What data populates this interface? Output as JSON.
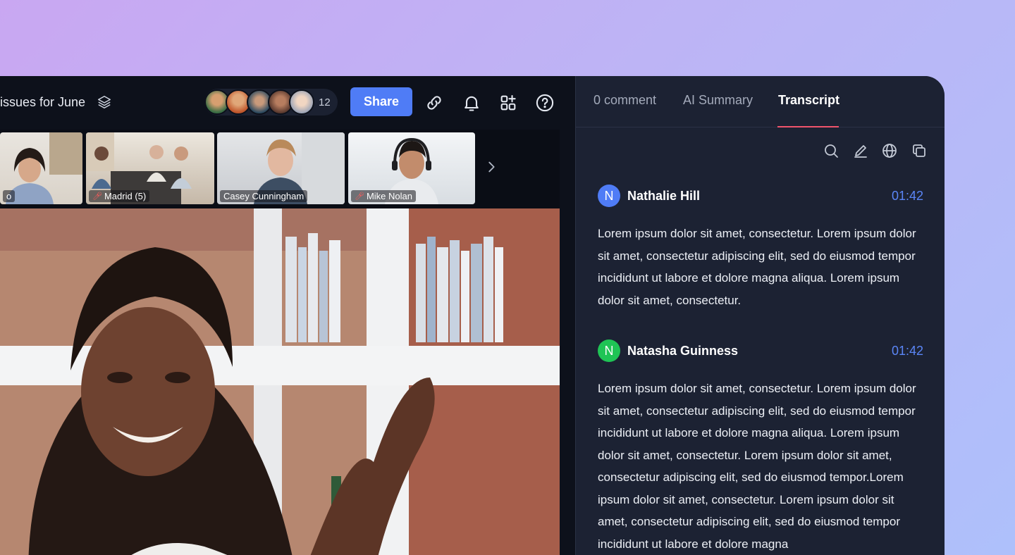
{
  "meeting": {
    "title": "issues for June",
    "participant_count": "12"
  },
  "toolbar": {
    "share_label": "Share",
    "icons": [
      "layers-icon",
      "link-icon",
      "bell-icon",
      "apps-add-icon",
      "help-icon"
    ]
  },
  "thumbnails": [
    {
      "label": "o",
      "muted": false
    },
    {
      "label": "Madrid (5)",
      "muted": true
    },
    {
      "label": "Casey Cunningham",
      "muted": false
    },
    {
      "label": "Mike Nolan",
      "muted": true
    }
  ],
  "panel": {
    "tabs": [
      {
        "label": "0 comment",
        "active": false
      },
      {
        "label": "AI Summary",
        "active": false
      },
      {
        "label": "Transcript",
        "active": true
      }
    ],
    "tool_icons": [
      "search-icon",
      "edit-icon",
      "globe-icon",
      "copy-icon"
    ],
    "accent": "#f0546c",
    "time_color": "#5b86f7"
  },
  "transcript": [
    {
      "initial": "N",
      "speaker": "Nathalie Hill",
      "time": "01:42",
      "badge_color": "#4f7cf6",
      "text": "Lorem ipsum dolor sit amet, consectetur. Lorem ipsum dolor sit amet, consectetur adipiscing elit, sed do eiusmod tempor incididunt ut labore et dolore magna aliqua. Lorem ipsum dolor sit amet, consectetur."
    },
    {
      "initial": "N",
      "speaker": "Natasha Guinness",
      "time": "01:42",
      "badge_color": "#1fc455",
      "text": "Lorem ipsum dolor sit amet, consectetur. Lorem ipsum dolor sit amet, consectetur adipiscing elit, sed do eiusmod tempor incididunt ut labore et dolore magna aliqua. Lorem ipsum dolor sit amet, consectetur. Lorem ipsum dolor sit amet, consectetur adipiscing elit, sed do eiusmod tempor.Lorem ipsum dolor sit amet, consectetur. Lorem ipsum dolor sit amet, consectetur adipiscing elit, sed do eiusmod tempor incididunt ut labore et dolore magna"
    }
  ]
}
